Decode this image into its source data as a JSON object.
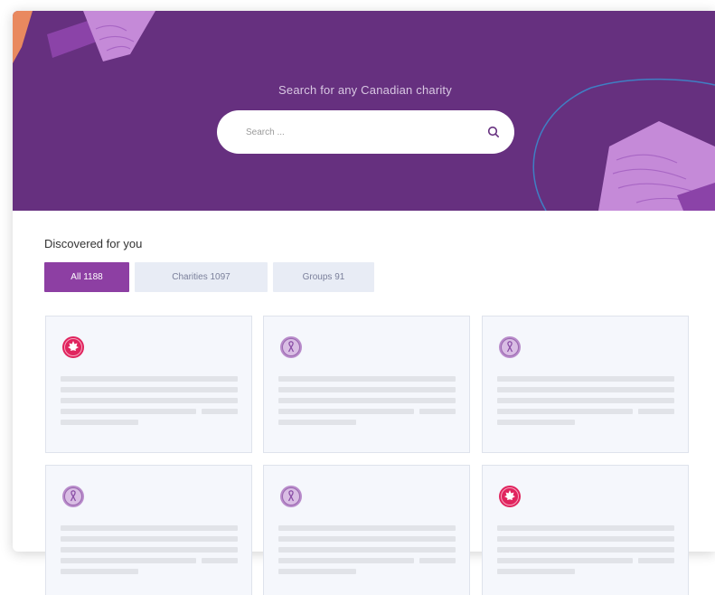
{
  "hero": {
    "title": "Search for any Canadian charity",
    "search_placeholder": "Search ...",
    "background_color": "#66307f"
  },
  "discover": {
    "title": "Discovered for you",
    "tabs": [
      {
        "label": "All 1188",
        "active": true
      },
      {
        "label": "Charities 1097",
        "active": false
      },
      {
        "label": "Groups 91",
        "active": false
      }
    ]
  },
  "cards": [
    {
      "logo": "maple-leaf-icon"
    },
    {
      "logo": "ribbon-icon"
    },
    {
      "logo": "ribbon-icon"
    },
    {
      "logo": "ribbon-icon"
    },
    {
      "logo": "ribbon-icon"
    },
    {
      "logo": "maple-leaf-icon"
    }
  ],
  "colors": {
    "accent": "#8d3fa3",
    "tab_inactive_bg": "#e8ecf5",
    "card_bg": "#f5f7fc",
    "maple_logo": "#e0245e",
    "ribbon_logo": "#b98ccb"
  }
}
